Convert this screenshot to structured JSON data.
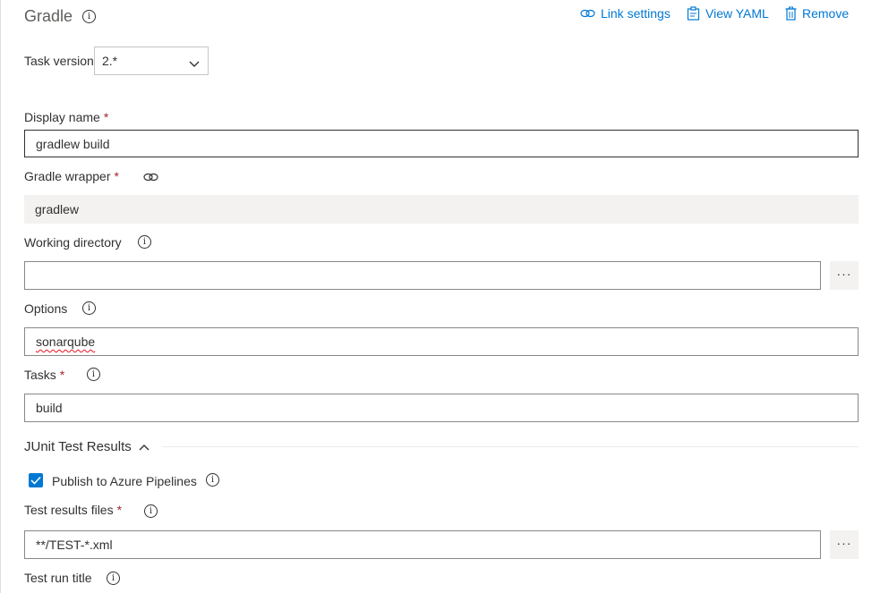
{
  "header": {
    "title": "Gradle",
    "link_settings": "Link settings",
    "view_yaml": "View YAML",
    "remove": "Remove"
  },
  "task_version": {
    "label": "Task version",
    "value": "2.*"
  },
  "display_name": {
    "label": "Display name",
    "value": "gradlew build"
  },
  "gradle_wrapper": {
    "label": "Gradle wrapper",
    "value": "gradlew"
  },
  "working_directory": {
    "label": "Working directory",
    "value": ""
  },
  "options": {
    "label": "Options",
    "value": "sonarqube"
  },
  "tasks": {
    "label": "Tasks",
    "value": "build"
  },
  "junit": {
    "section_title": "JUnit Test Results",
    "expanded": true,
    "publish_label": "Publish to Azure Pipelines",
    "publish_checked": true,
    "test_results_files_label": "Test results files",
    "test_results_files_value": "**/TEST-*.xml",
    "test_run_title_label": "Test run title"
  },
  "misc": {
    "required_mark": "*",
    "info_glyph": "i",
    "ellipsis": "···"
  },
  "colors": {
    "accent": "#0078d4",
    "required": "#a4262c",
    "readonly_bg": "#f3f2f1"
  }
}
